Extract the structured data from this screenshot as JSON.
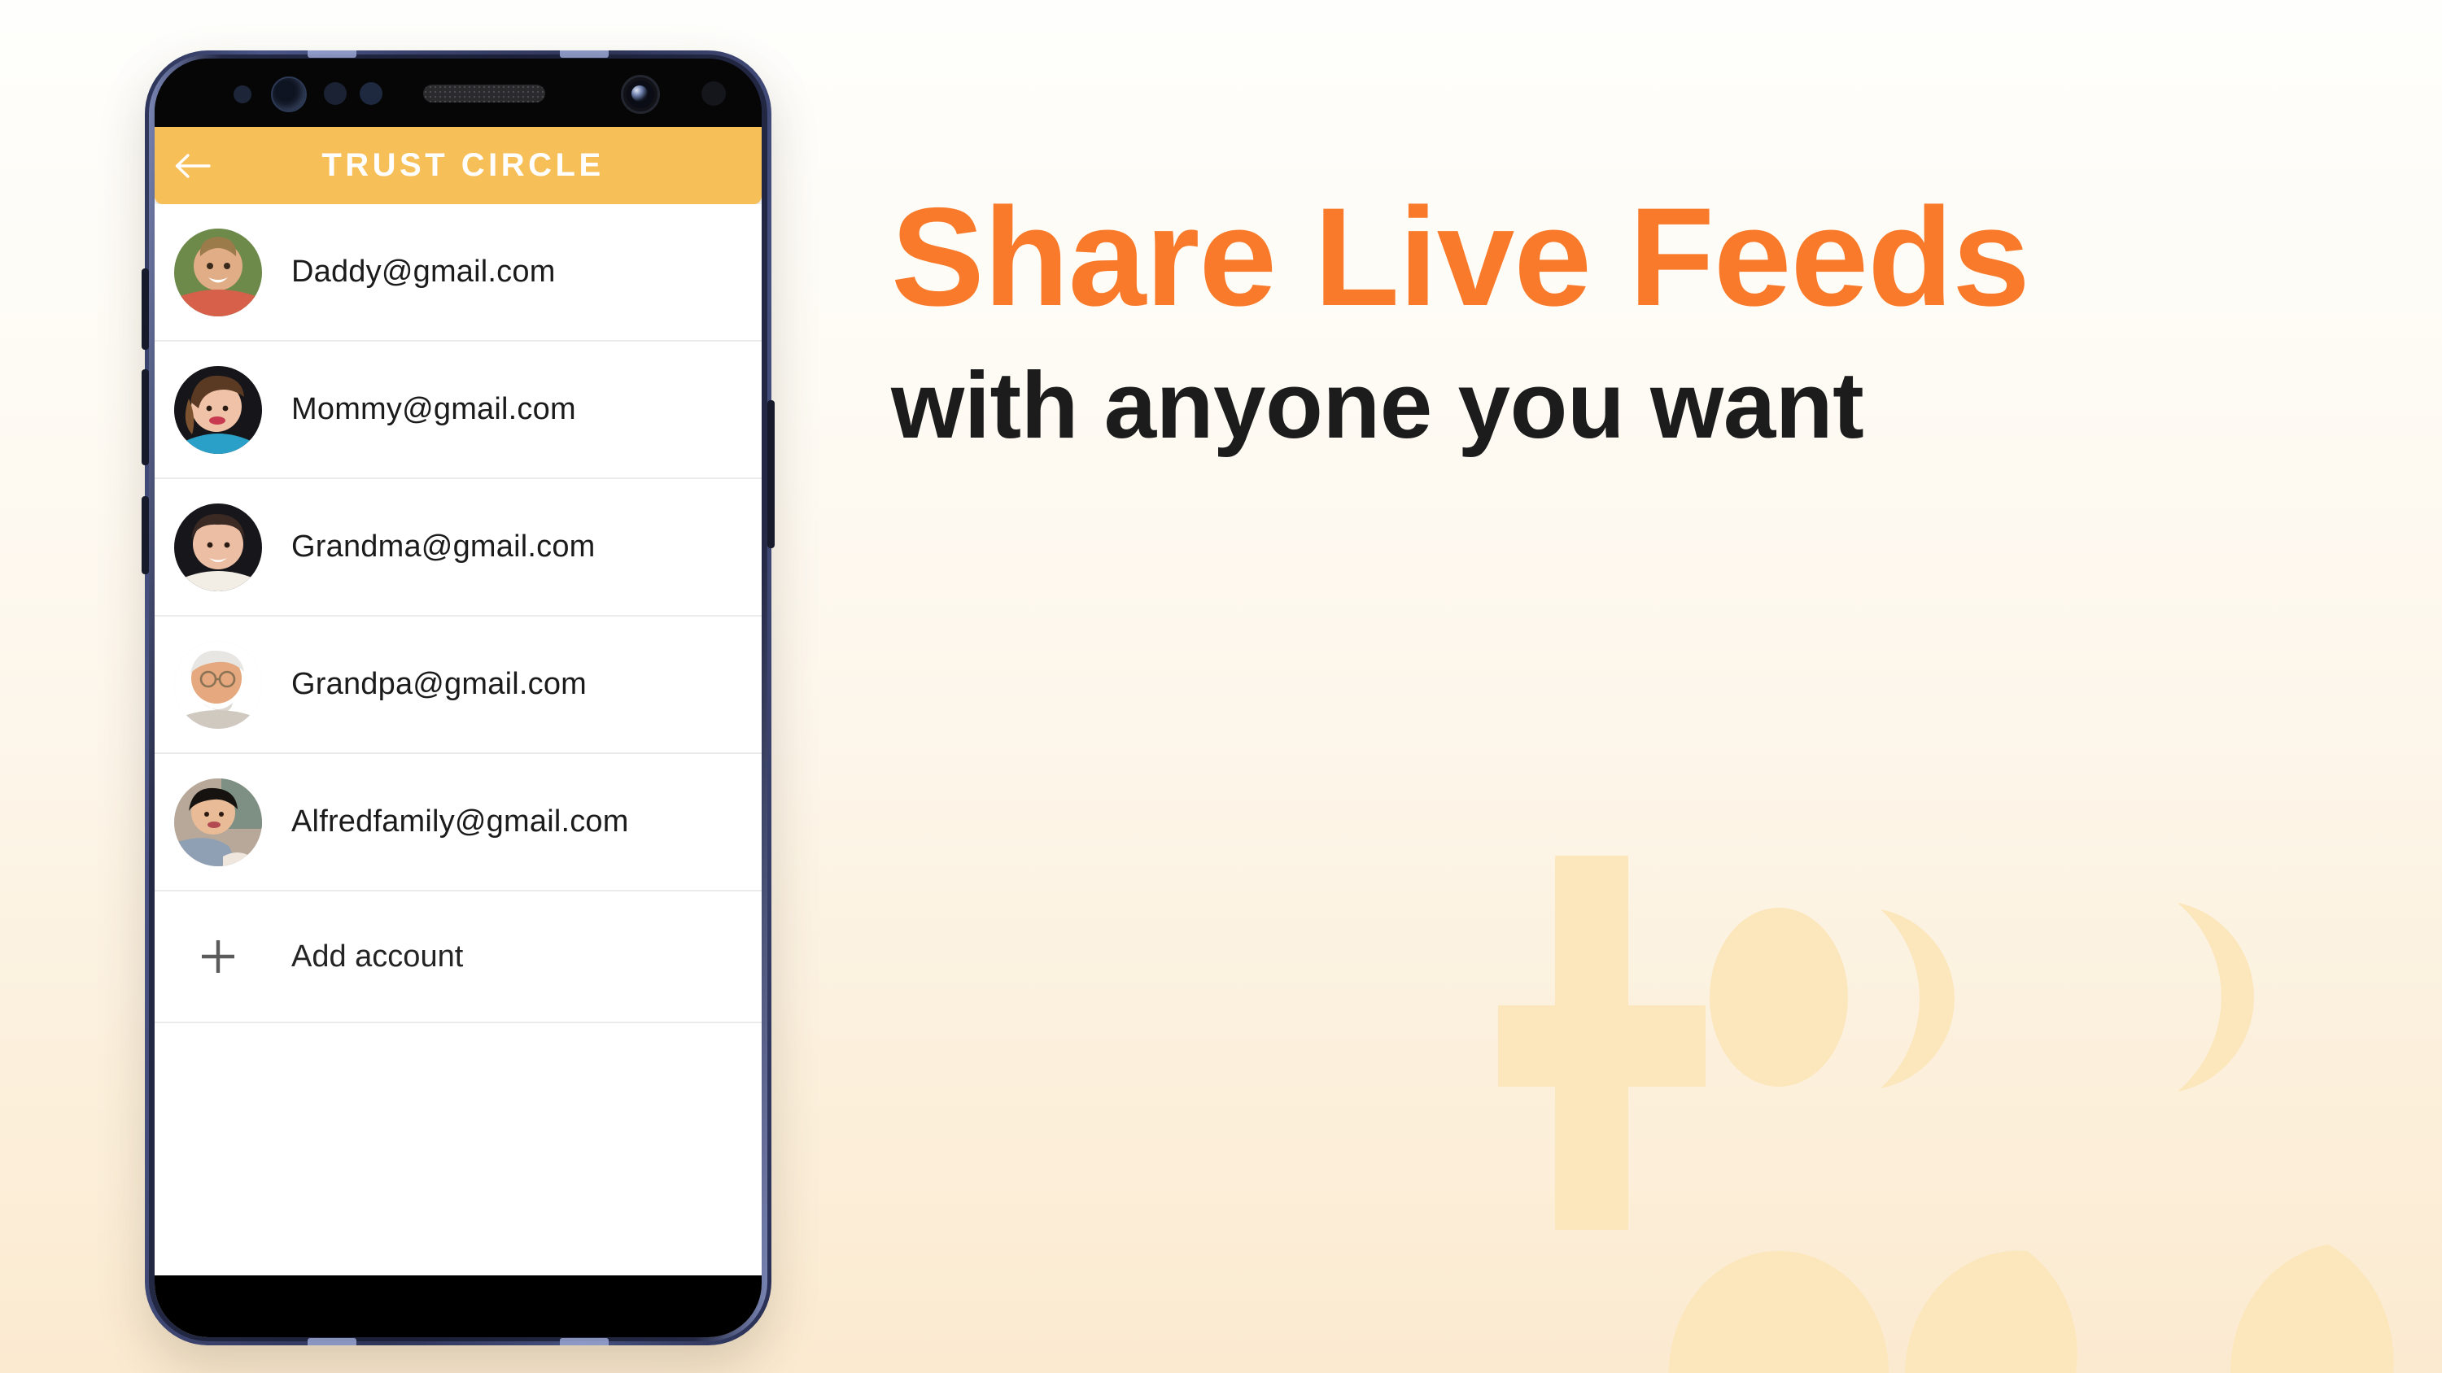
{
  "theme": {
    "accent_orange": "#F87A2A",
    "appbar_yellow": "#F7BF58",
    "heading_dark": "#1C1C1C",
    "watermark_fill": "#FCE6BB",
    "bg_top": "#FEFEFC",
    "bg_bottom": "#FBEAD0",
    "phone_frame": "#3B4468"
  },
  "phone": {
    "sensors": {
      "proximity": "proximity-sensor",
      "iris": "iris-scanner",
      "light1": "light-sensor",
      "light2": "light-sensor",
      "speaker": "earpiece-speaker",
      "camera": "front-camera",
      "extra": "sensor-dot"
    },
    "buttons": {
      "volume_up": "Volume Up",
      "volume_down": "Volume Down",
      "bixby": "Bixby",
      "power": "Power"
    }
  },
  "app": {
    "appbar": {
      "back_icon": "back-arrow-icon",
      "title": "TRUST CIRCLE"
    },
    "accounts": [
      {
        "email": "Daddy@gmail.com",
        "avatar": "man-smiling-outdoors"
      },
      {
        "email": "Mommy@gmail.com",
        "avatar": "woman-with-earphones"
      },
      {
        "email": "Grandma@gmail.com",
        "avatar": "elderly-woman-smiling"
      },
      {
        "email": "Grandpa@gmail.com",
        "avatar": "elderly-man-with-glasses"
      },
      {
        "email": "Alfredfamily@gmail.com",
        "avatar": "woman-at-cafe"
      }
    ],
    "add_account": {
      "icon": "plus-icon",
      "label": "Add account"
    }
  },
  "marketing": {
    "headline": "Share Live Feeds",
    "subheading": "with anyone you want"
  },
  "decoration": {
    "watermark": "add-users-icon"
  }
}
